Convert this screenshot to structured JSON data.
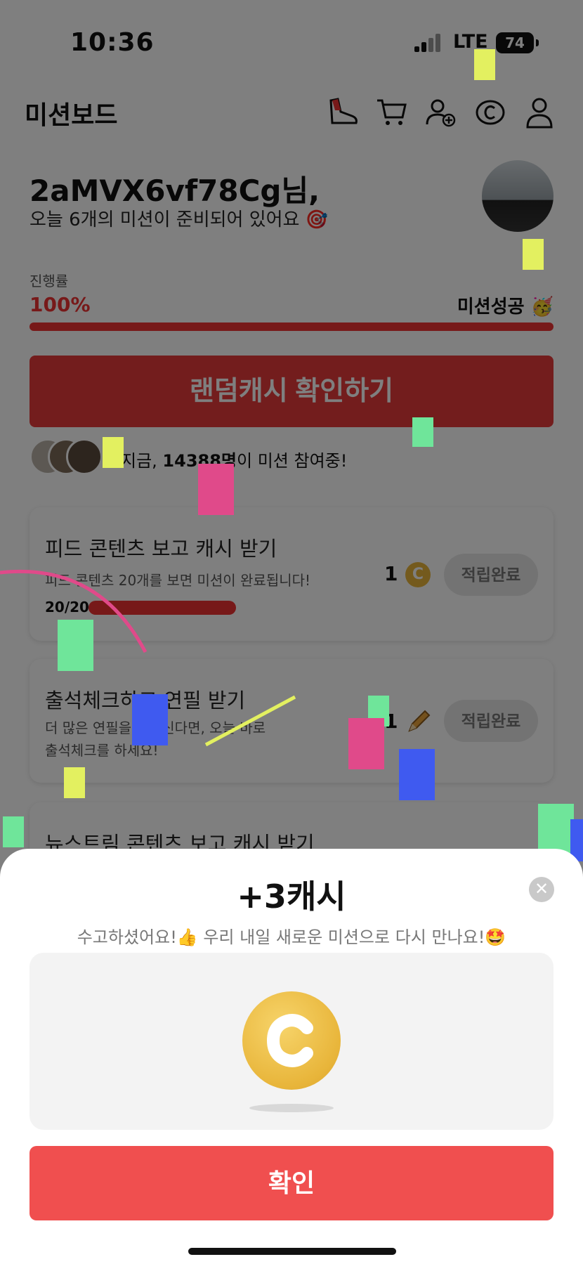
{
  "status_bar": {
    "time": "10:36",
    "network": "LTE",
    "battery": "74"
  },
  "header": {
    "title": "미션보드",
    "icons": [
      "shoe-icon",
      "cart-icon",
      "add-user-icon",
      "coin-history-icon",
      "profile-icon"
    ]
  },
  "greeting": {
    "name": "2aMVX6vf78Cg님,",
    "subtitle": "오늘 6개의 미션이 준비되어 있어요 🎯"
  },
  "progress": {
    "label": "진행률",
    "value_text": "100%",
    "fraction": 1.0,
    "status": "미션성공 🥳"
  },
  "random_cash_button": "랜덤캐시 확인하기",
  "participants": {
    "prefix": "지금, ",
    "count": "14388명",
    "suffix": "이 미션 참여중!"
  },
  "missions": [
    {
      "title": "피드 콘텐츠 보고 캐시 받기",
      "description": "피드 콘텐츠 20개를 보면 미션이 완료됩니다!",
      "progress_text": "20/20",
      "progress_fraction": 1.0,
      "reward": "1",
      "reward_icon": "coin-icon",
      "button": "적립완료"
    },
    {
      "title": "출석체크하고 연필 받기",
      "description_line1": "더 많은 연필을 원하신다면, 오늘 바로",
      "description_line2": "출석체크를 하세요!",
      "reward": "1",
      "reward_icon": "pencil-icon",
      "button": "적립완료"
    },
    {
      "title": "뉴스트림 콘텐츠 보고 캐시 받기"
    }
  ],
  "reward_sheet": {
    "title": "+3캐시",
    "subtitle": "수고하셨어요!👍 우리 내일 새로운 미션으로 다시 만나요!🤩",
    "close_icon": "close-icon",
    "confirm_button": "확인"
  },
  "colors": {
    "accent_red": "#e63a3a",
    "confirm_red": "#f04f4f",
    "coin_gold": "#e8b53a"
  }
}
